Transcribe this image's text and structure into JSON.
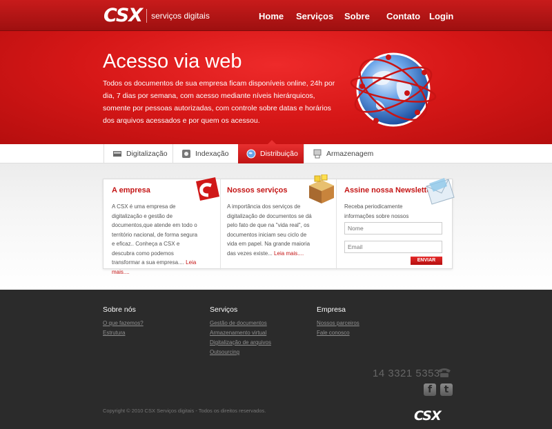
{
  "brand": {
    "logo": "CSX",
    "tagline": "serviços digitais"
  },
  "nav": [
    "Home",
    "Serviços",
    "Sobre",
    "Contato",
    "Login"
  ],
  "hero": {
    "title": "Acesso via web",
    "text": "Todos os documentos de sua empresa ficam disponíveis online, 24h por dia, 7 dias por semana, com acesso mediante níveis hierárquicos, somente por pessoas autorizadas, com controle sobre datas e horários dos arquivos acessados e por quem os acessou."
  },
  "tabs": [
    {
      "label": "Digitalização",
      "icon": "scanner-icon"
    },
    {
      "label": "Indexação",
      "icon": "index-icon"
    },
    {
      "label": "Distribuição",
      "icon": "globe-icon",
      "active": true
    },
    {
      "label": "Armazenagem",
      "icon": "storage-icon"
    }
  ],
  "boxes": {
    "empresa": {
      "title": "A empresa",
      "text": "A CSX é uma empresa de digitalização e gestão de documentos,que atende em todo o território nacional, de forma segura e eficaz.. Conheça a CSX e descubra como podemos transformar a sua empresa....",
      "more": "Leia mais...."
    },
    "servicos": {
      "title": "Nossos serviços",
      "text": "A importância dos serviços de digitalização de documentos se dá pelo fato de que na \"vida real\", os documentos iniciam seu ciclo de vida em papel. Na grande maioria das vezes existe...",
      "more": "Leia mais...."
    },
    "newsletter": {
      "title": "Assine nossa Newsletter",
      "text": "Receba periodicamente informações sobre nossos produtos e serviços.",
      "name_placeholder": "Nome",
      "email_placeholder": "Email",
      "send_label": "ENVIAR"
    }
  },
  "footer": {
    "col1": {
      "title": "Sobre nós",
      "links": [
        "O que fazemos?",
        "Estrutura"
      ]
    },
    "col2": {
      "title": "Serviços",
      "links": [
        "Gestão de documentos",
        "Armazenamento virtual",
        "Digitalização de arquivos",
        "Outsourcing"
      ]
    },
    "col3": {
      "title": "Empresa",
      "links": [
        "Nossos parceiros",
        "Fale conosco"
      ]
    },
    "phone": "14 3321  5353",
    "social": [
      "f",
      "t"
    ],
    "copyright": "Copyright © 2010 CSX Serviços digitais - Todos os direitos reservados.",
    "logo": "CSX"
  },
  "colors": {
    "brand_red": "#c41414",
    "footer_bg": "#2b2b2b"
  }
}
